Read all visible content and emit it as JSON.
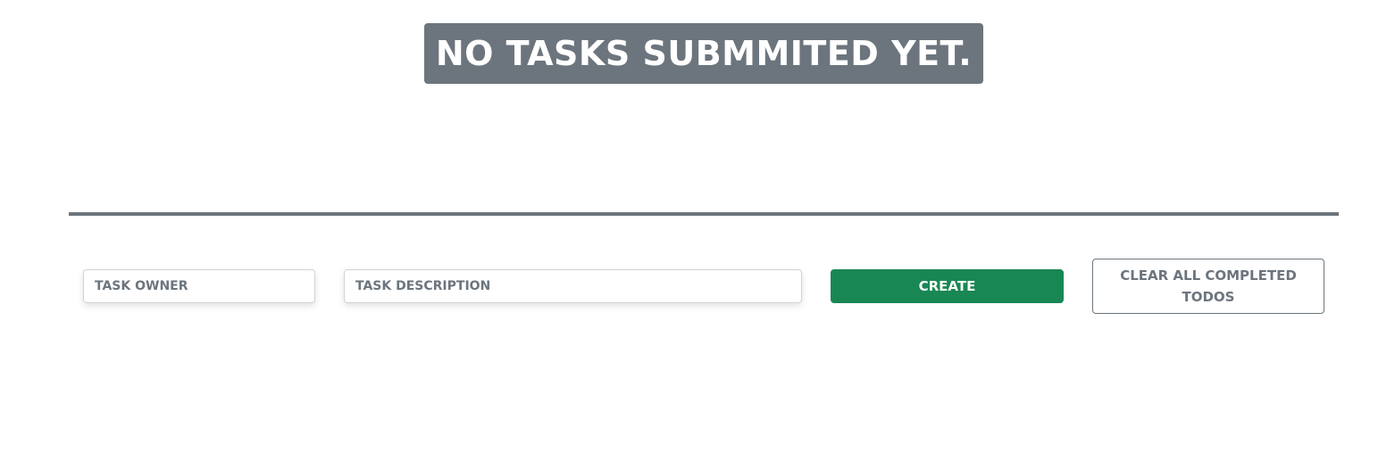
{
  "header": {
    "empty_message": "NO TASKS SUBMMITED YET."
  },
  "form": {
    "owner_placeholder": "TASK OWNER",
    "owner_value": "",
    "description_placeholder": "TASK DESCRIPTION",
    "description_value": "",
    "create_label": "CREATE",
    "clear_label": "CLEAR ALL COMPLETED TODOS"
  },
  "colors": {
    "banner_bg": "#6c757d",
    "primary_success": "#198754",
    "secondary": "#6c757d"
  }
}
